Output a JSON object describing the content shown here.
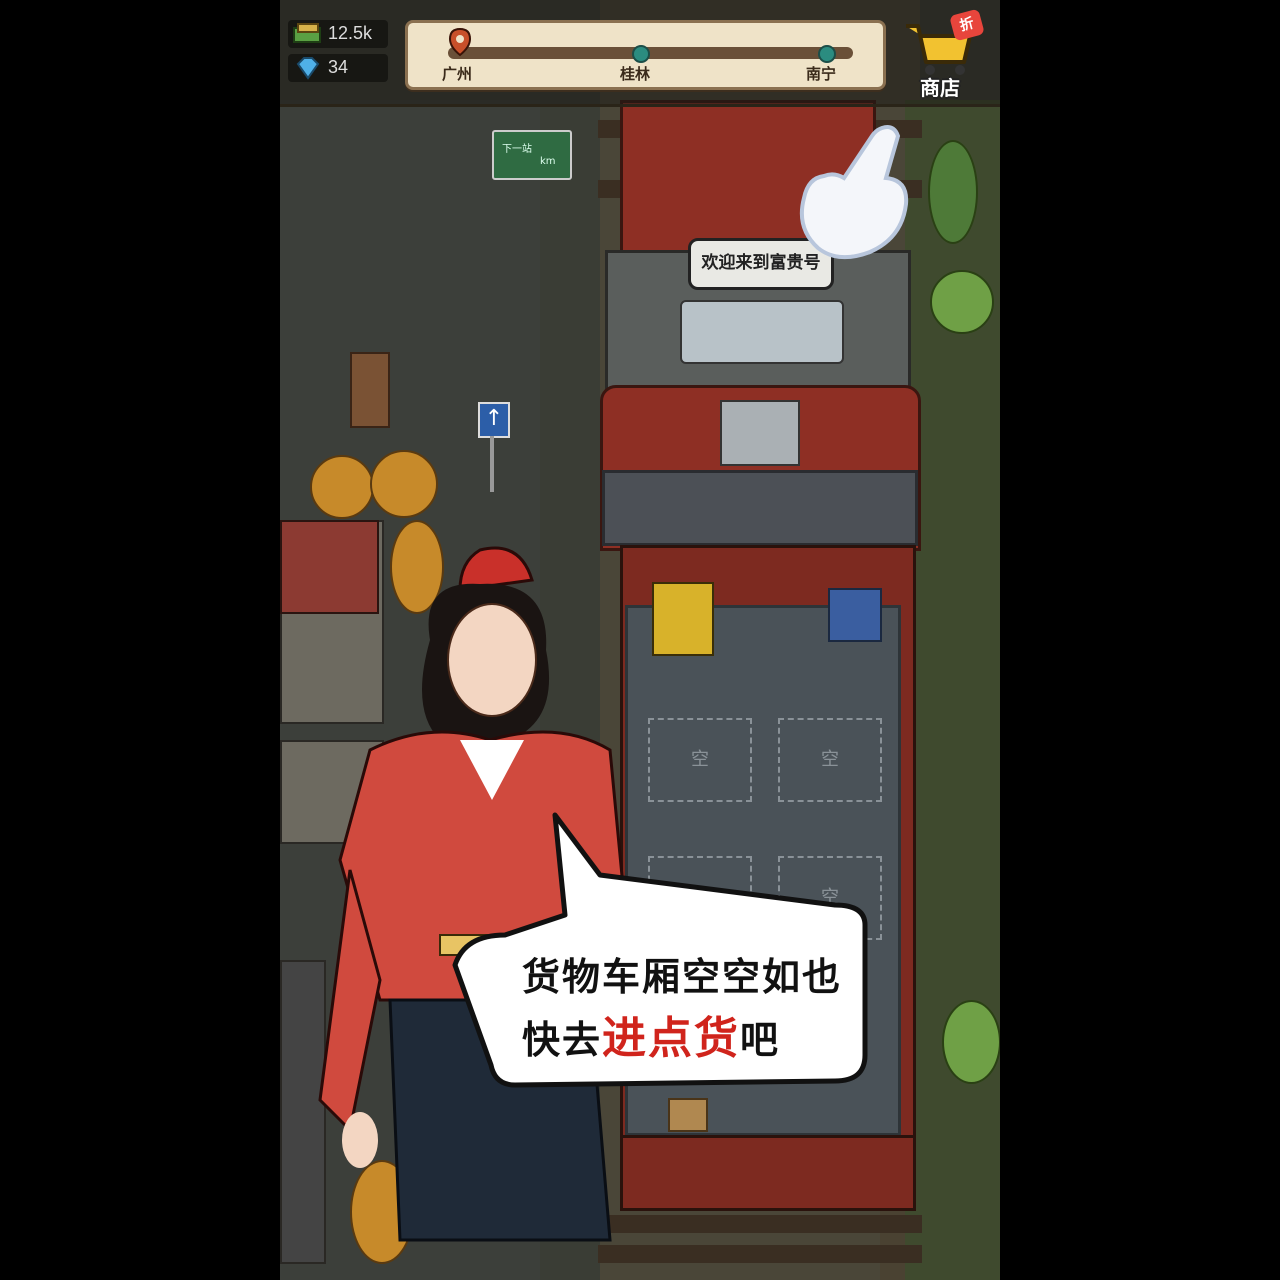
{
  "resources": {
    "cash": "12.5k",
    "gems": "34"
  },
  "route": {
    "stations": [
      "广州",
      "桂林",
      "南宁"
    ]
  },
  "shop": {
    "label": "商店",
    "badge": "折"
  },
  "welcome_bubble": "欢迎来到富贵号",
  "next_station_sign": {
    "title": "下一站",
    "unit": "km"
  },
  "cargo_slots": [
    "空",
    "空",
    "空",
    "空"
  ],
  "dialog": {
    "line1": "货物车厢空空如也",
    "line2_prefix": "快去",
    "line2_highlight": "进点货",
    "line2_suffix": "吧"
  },
  "colors": {
    "highlight": "#d0241c",
    "route_dot": "#2b8c80",
    "train_red": "#8e2f24"
  }
}
